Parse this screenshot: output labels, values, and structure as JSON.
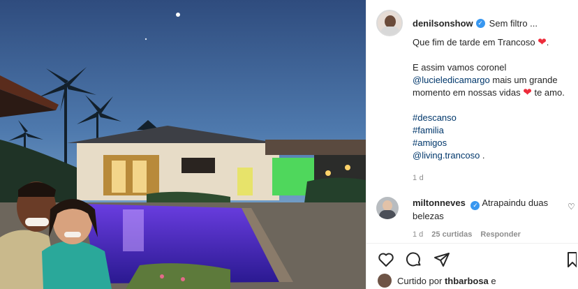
{
  "post": {
    "handle": "denilsonshow",
    "location": "Sem filtro ...",
    "caption": {
      "line1": "Que fim de tarde em Trancoso",
      "line1_end": ".",
      "line2": "E assim vamos coronel",
      "mention1": "@lucieledicamargo",
      "line3_rest": " mais um grande",
      "line4": "momento em nossas vidas",
      "line4_end": "te amo.",
      "tags": [
        "#descanso",
        "#familia",
        "#amigos"
      ],
      "mention2": "@living.trancoso",
      "mention2_end": " ."
    },
    "time": "1 d"
  },
  "comment": {
    "handle": "miltonneves",
    "text": "Atrapaindu duas belezas",
    "time": "1 d",
    "likes": "25 curtidas",
    "reply": "Responder"
  },
  "likes_line": {
    "prefix": "Curtido por",
    "user": "thbarbosa",
    "suffix": "e"
  },
  "icons": {
    "verified": "verified-badge-icon",
    "heart": "heart-icon",
    "comment": "comment-icon",
    "share": "share-icon",
    "save": "bookmark-icon"
  },
  "colors": {
    "verified": "#3897f0",
    "heart_emoji": "#ed2c3b",
    "link": "#00376b",
    "meta": "#8e8e8e"
  }
}
